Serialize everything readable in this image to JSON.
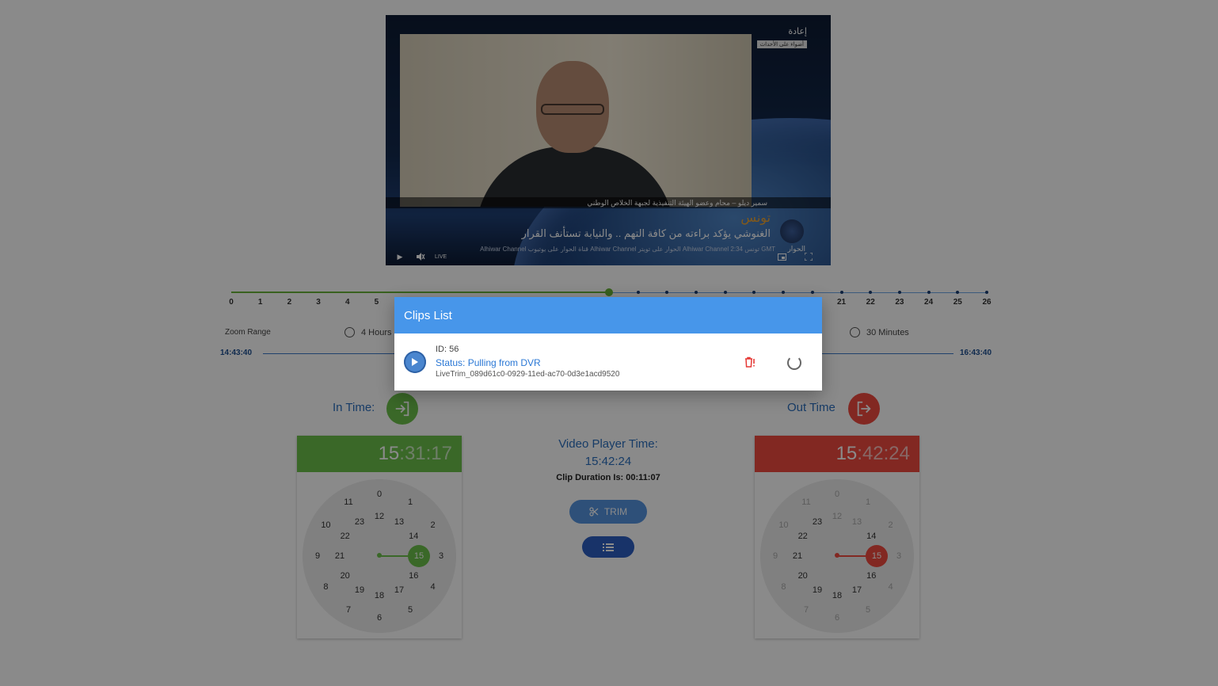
{
  "video": {
    "tag_top": "إعادة",
    "tag_sub": "أضواء على الأحداث",
    "name_bar": "سمير ديلو – محام وعضو الهيئة التنفيذية لجبهة الخلاص الوطني",
    "country": "تونس",
    "headline": "الغنوشي يؤكد براءته من كافة التهم .. والنيابة تستأنف القرار",
    "ticker": "Alhiwar Channel قناة الحوار على يوتيوب   Alhiwar Channel الحوار على تويتر   Alhiwar Channel تونس 2:34 GMT",
    "logo_label": "الحوار",
    "live_label": "LIVE"
  },
  "timeline": {
    "labels": [
      "0",
      "1",
      "2",
      "3",
      "4",
      "5",
      "21",
      "22",
      "23",
      "24",
      "25",
      "26"
    ],
    "max": 26,
    "current": 13
  },
  "zoom": {
    "label": "Zoom Range",
    "option_4h": "4 Hours",
    "option_30m": "30 Minutes"
  },
  "range": {
    "start": "14:43:40",
    "end": "16:43:40"
  },
  "in_time": {
    "label": "In Time:",
    "hh": "15",
    "mm_ss": "31:17",
    "selected": "15"
  },
  "out_time": {
    "label": "Out Time",
    "hh": "15",
    "mm_ss": "42:24",
    "selected": "15"
  },
  "player": {
    "label": "Video Player Time:",
    "time": "15:42:24",
    "duration": "Clip Duration Is: 00:11:07"
  },
  "trim_label": "TRIM",
  "clock_numbers": {
    "outer": [
      "0",
      "1",
      "2",
      "3",
      "4",
      "5",
      "6",
      "7",
      "8",
      "9",
      "10",
      "11"
    ],
    "inner": [
      "12",
      "13",
      "14",
      "15",
      "16",
      "17",
      "18",
      "19",
      "20",
      "21",
      "22",
      "23"
    ]
  },
  "modal": {
    "title": "Clips List",
    "clip": {
      "id": "ID: 56",
      "status": "Status: Pulling from DVR",
      "file": "LiveTrim_089d61c0-0929-11ed-ac70-0d3e1acd9520"
    }
  },
  "colors": {
    "green": "#6cc04a",
    "red": "#f04a40",
    "blue": "#4796ea",
    "overlay": "rgba(0,0,0,0.46)"
  }
}
